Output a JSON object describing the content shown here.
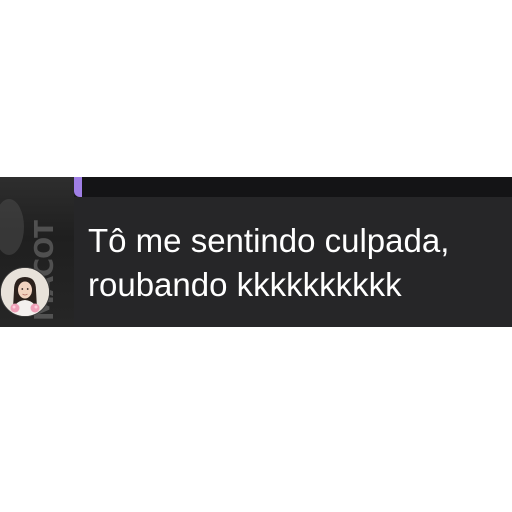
{
  "message": {
    "line1": "Tô me sentindo culpada,",
    "line2": "roubando kkkkkkkkkk"
  },
  "background_photo_text": "MACOT",
  "colors": {
    "chat_background": "#1c1c1e",
    "bubble": "#262628",
    "reply_accent": "#a07fe6",
    "text": "#ffffff"
  },
  "icons": {
    "avatar": "profile-photo"
  }
}
